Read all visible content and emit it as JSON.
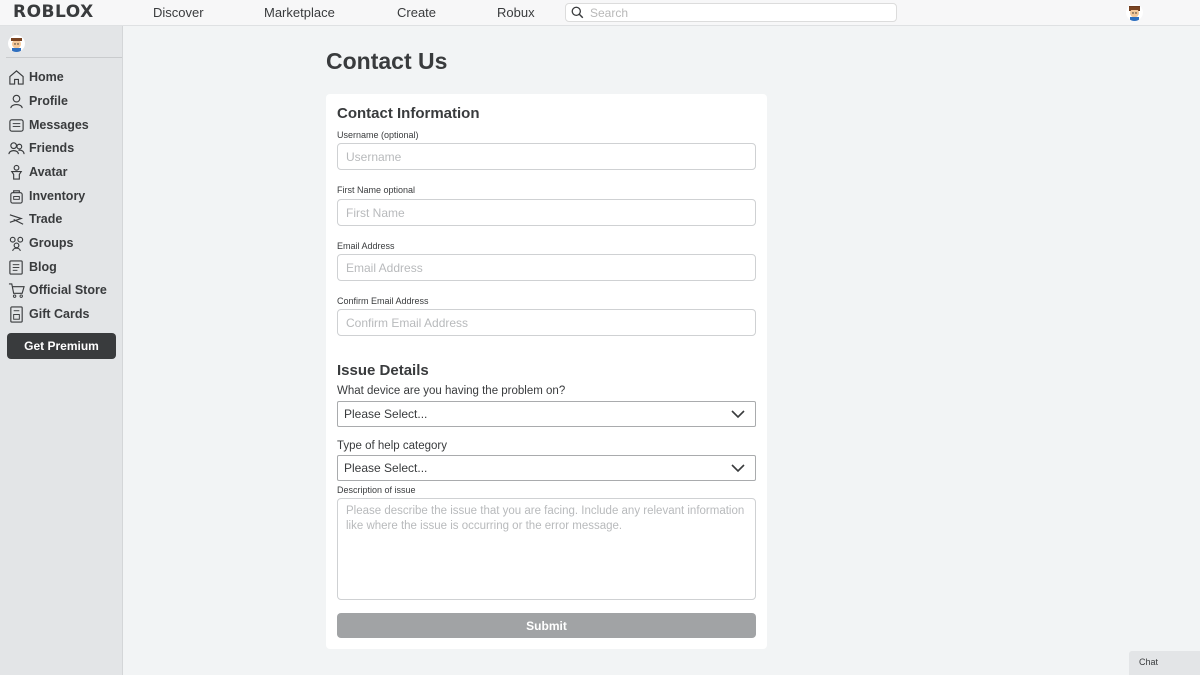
{
  "header": {
    "logo": "ROBLOX",
    "nav": [
      "Discover",
      "Marketplace",
      "Create",
      "Robux"
    ],
    "search_placeholder": "Search"
  },
  "sidebar": {
    "items": [
      {
        "label": "Home",
        "icon": "home-icon"
      },
      {
        "label": "Profile",
        "icon": "profile-icon"
      },
      {
        "label": "Messages",
        "icon": "messages-icon"
      },
      {
        "label": "Friends",
        "icon": "friends-icon"
      },
      {
        "label": "Avatar",
        "icon": "avatar-icon"
      },
      {
        "label": "Inventory",
        "icon": "inventory-icon"
      },
      {
        "label": "Trade",
        "icon": "trade-icon"
      },
      {
        "label": "Groups",
        "icon": "groups-icon"
      },
      {
        "label": "Blog",
        "icon": "blog-icon"
      },
      {
        "label": "Official Store",
        "icon": "cart-icon"
      },
      {
        "label": "Gift Cards",
        "icon": "gift-card-icon"
      }
    ],
    "premium_label": "Get Premium"
  },
  "main": {
    "title": "Contact Us",
    "contact": {
      "heading": "Contact Information",
      "username_label": "Username (optional)",
      "username_placeholder": "Username",
      "firstname_label": "First Name optional",
      "firstname_placeholder": "First Name",
      "email_label": "Email Address",
      "email_placeholder": "Email Address",
      "confirm_label": "Confirm Email Address",
      "confirm_placeholder": "Confirm Email Address"
    },
    "issue": {
      "heading": "Issue Details",
      "device_question": "What device are you having the problem on?",
      "device_value": "Please Select...",
      "category_question": "Type of help category",
      "category_value": "Please Select...",
      "description_label": "Description of issue",
      "description_placeholder": "Please describe the issue that you are facing. Include any relevant information like where the issue is occurring or the error message."
    },
    "submit_label": "Submit"
  },
  "chat_label": "Chat"
}
